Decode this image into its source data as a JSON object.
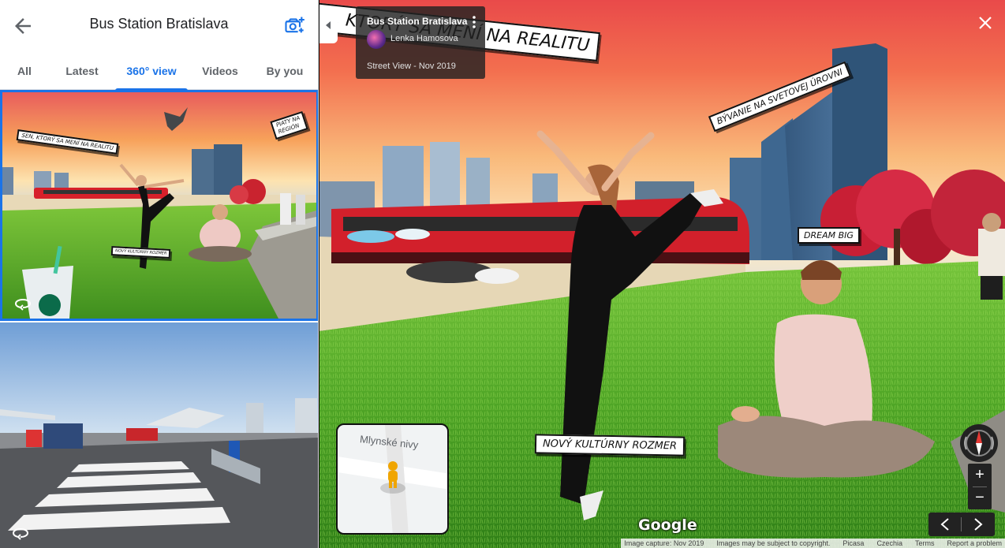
{
  "panel": {
    "title": "Bus Station Bratislava",
    "back_icon": "arrow-left-icon",
    "add_photo_icon": "camera-plus-icon",
    "tabs": [
      {
        "label": "All",
        "active": false
      },
      {
        "label": "Latest",
        "active": false
      },
      {
        "label": "360° view",
        "active": true
      },
      {
        "label": "Videos",
        "active": false
      },
      {
        "label": "By you",
        "active": false
      }
    ],
    "accent": "#1a73e8",
    "thumbnails": [
      {
        "selected": true,
        "signs": [
          "SEN, KTORÝ SA MENÍ NA REALITU",
          "PIATY NA",
          "REGIÓN",
          "NOVÝ KULTÚRNY ROZMER"
        ],
        "badge_icon": "360-rotate-icon"
      },
      {
        "selected": false,
        "badge_icon": "360-rotate-icon"
      }
    ]
  },
  "viewer": {
    "info_card": {
      "title": "Bus Station Bratislava",
      "author": "Lenka Hamosova",
      "capture": "Street View - Nov 2019"
    },
    "signs": {
      "top": "N, KTORÝ SA MENÍ NA REALITU",
      "right": "BÝVANIE NA SVETOVEJ ÚROVNI",
      "dream": "DREAM BIG",
      "bottom": "NOVÝ KULTÚRNY ROZMER"
    },
    "minimap_label": "Mlynské nivy",
    "logo": "Google",
    "zoom_in": "+",
    "zoom_out": "−",
    "footer": [
      "Image capture: Nov 2019",
      "Images may be subject to copyright.",
      "Picasa",
      "Czechia",
      "Terms",
      "Report a problem"
    ]
  }
}
